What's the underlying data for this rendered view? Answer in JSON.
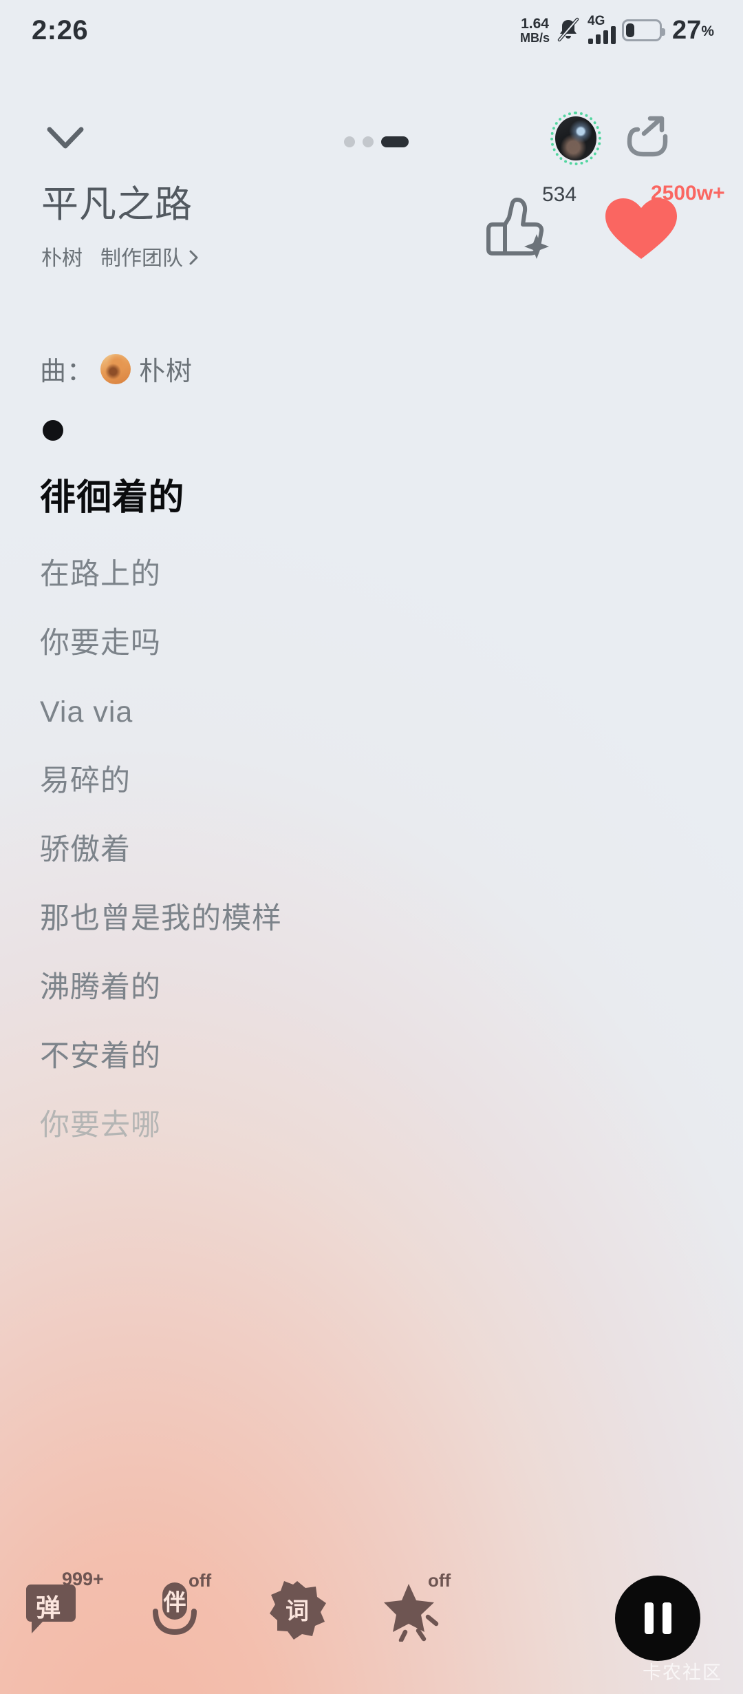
{
  "status_bar": {
    "clock": "2:26",
    "net_speed_value": "1.64",
    "net_speed_unit": "MB/s",
    "mute_icon": "bell-muted-icon",
    "network_type": "4G",
    "signal_icon": "signal-bars-icon",
    "battery_icon": "battery-icon",
    "battery_percent": "27",
    "battery_percent_symbol": "%",
    "battery_level": 27
  },
  "nav": {
    "collapse_icon": "chevron-down-icon",
    "page_dots": [
      "inactive",
      "inactive",
      "active"
    ],
    "avatar_icon": "user-avatar",
    "share_icon": "share-icon"
  },
  "song": {
    "title": "平凡之路",
    "artist": "朴树",
    "production_team_label": "制作团队",
    "production_team_chevron": "chevron-right-icon"
  },
  "reactions": {
    "thumb_icon": "thumbs-up-sparkle-icon",
    "thumb_count": "534",
    "heart_icon": "heart-filled-icon",
    "heart_count": "2500w+",
    "heart_color": "#FA6661"
  },
  "composer": {
    "label": "曲：",
    "avatar_icon": "composer-avatar",
    "name": "朴树"
  },
  "lyrics": {
    "bullet_icon": "lyric-dot-indicator",
    "lines": [
      {
        "text": "徘徊着的",
        "state": "active"
      },
      {
        "text": "在路上的",
        "state": "normal"
      },
      {
        "text": "你要走吗",
        "state": "normal"
      },
      {
        "text": "Via via",
        "state": "normal"
      },
      {
        "text": "易碎的",
        "state": "normal"
      },
      {
        "text": "骄傲着",
        "state": "normal"
      },
      {
        "text": "那也曾是我的模样",
        "state": "normal"
      },
      {
        "text": "沸腾着的",
        "state": "normal"
      },
      {
        "text": "不安着的",
        "state": "normal"
      },
      {
        "text": "你要去哪",
        "state": "faded"
      }
    ]
  },
  "toolbar": {
    "items": [
      {
        "icon": "danmaku-bubble-icon",
        "glyph": "弹",
        "badge": "999+"
      },
      {
        "icon": "accompaniment-icon",
        "glyph": "伴",
        "badge": "off"
      },
      {
        "icon": "lyrics-flower-icon",
        "glyph": "词",
        "badge": ""
      },
      {
        "icon": "effects-star-icon",
        "glyph": "",
        "badge": "off"
      }
    ],
    "play_pause_icon": "pause-icon"
  },
  "watermark": "卡农社区"
}
